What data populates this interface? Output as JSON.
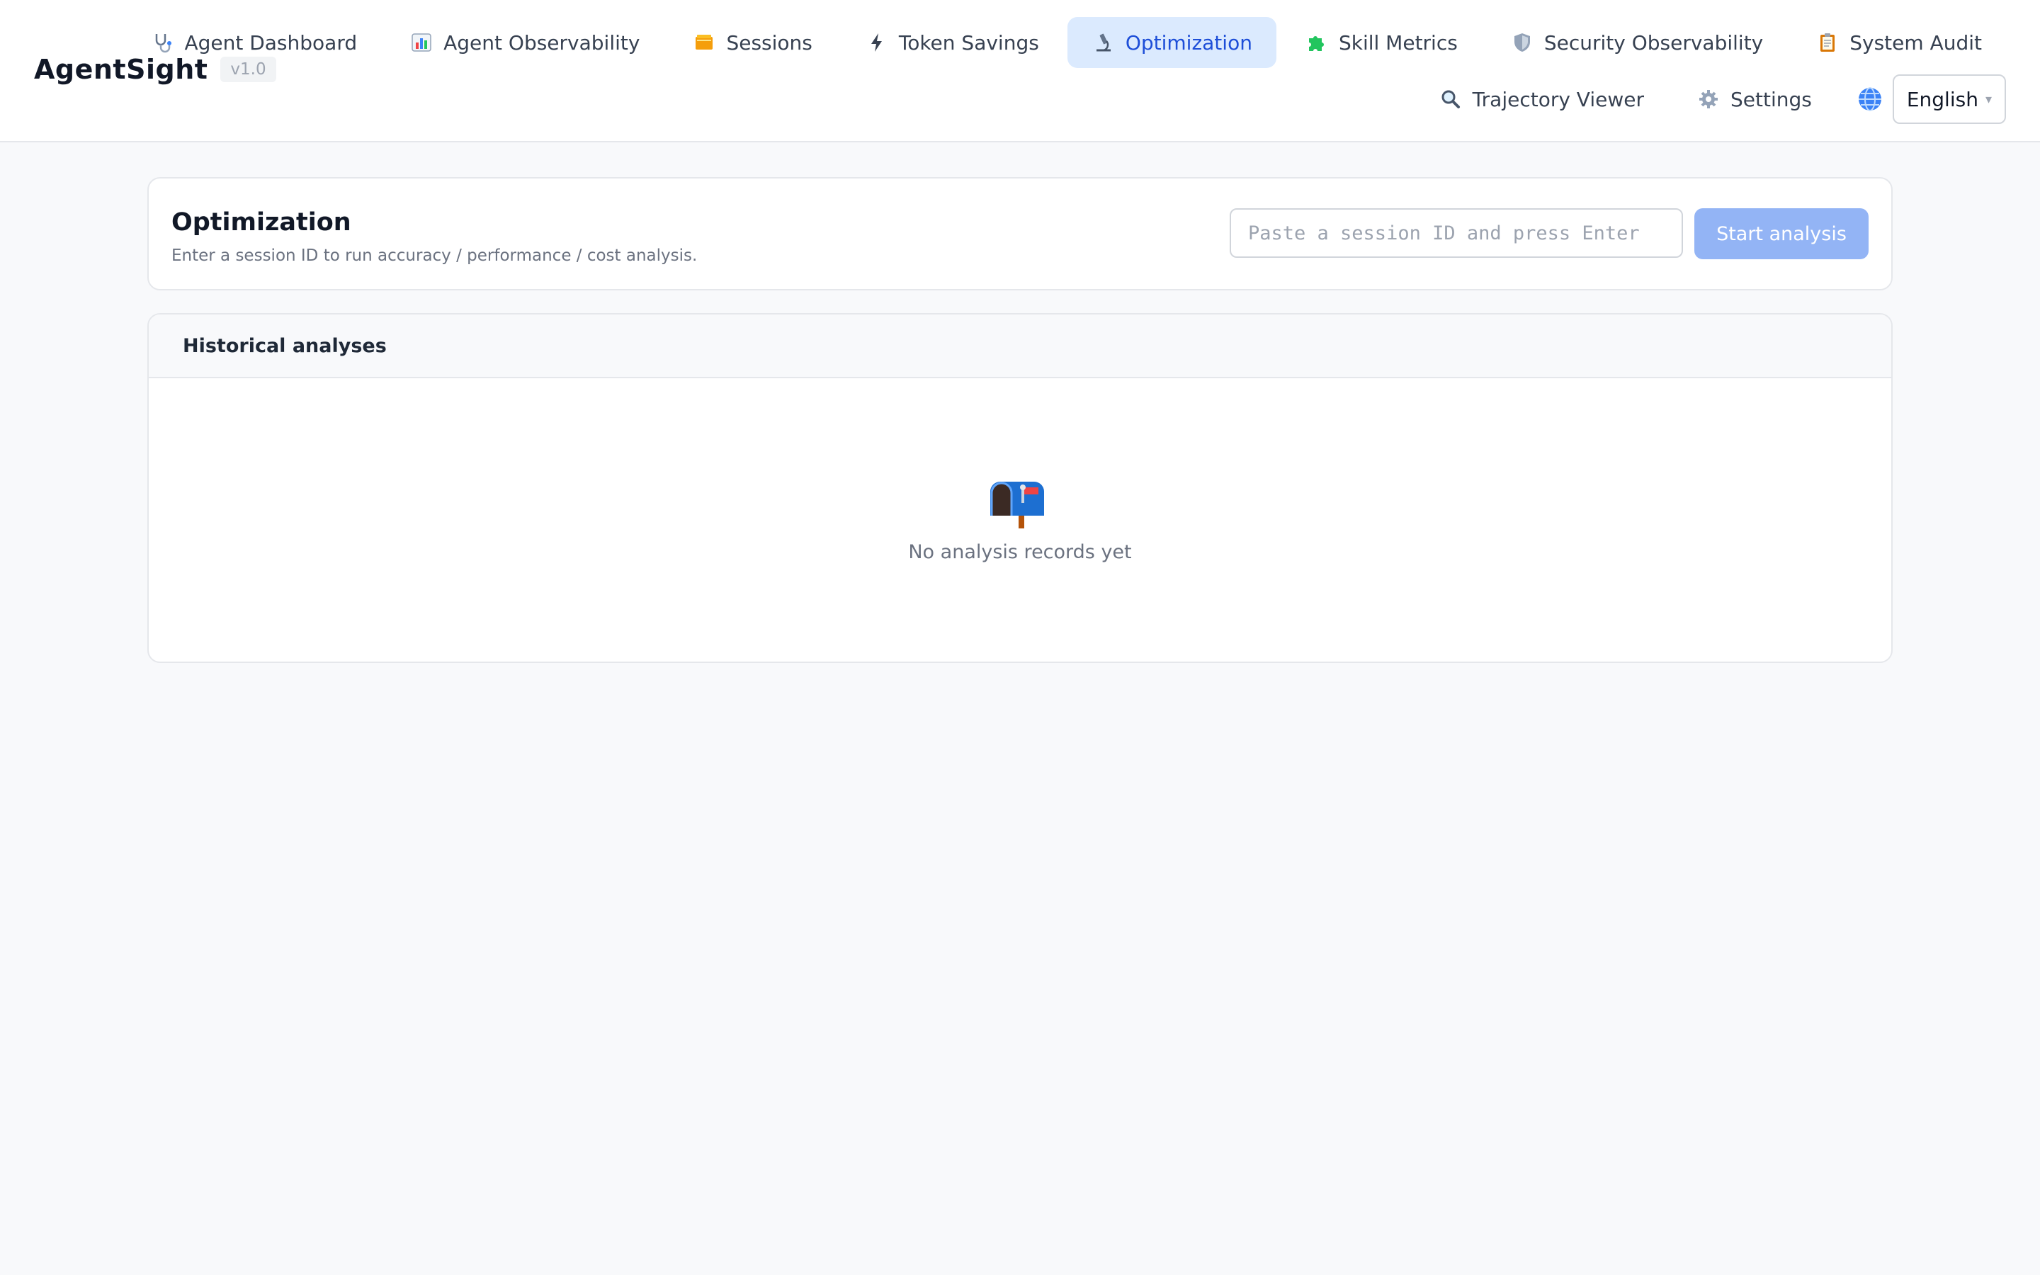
{
  "app": {
    "name": "AgentSight",
    "version": "v1.0"
  },
  "nav": {
    "row1": [
      {
        "label": "Agent Dashboard",
        "icon": "stethoscope-icon",
        "active": false
      },
      {
        "label": "Agent Observability",
        "icon": "bar-chart-icon",
        "active": false
      },
      {
        "label": "Sessions",
        "icon": "card-index-icon",
        "active": false
      },
      {
        "label": "Token Savings",
        "icon": "lightning-icon",
        "active": false
      },
      {
        "label": "Optimization",
        "icon": "microscope-icon",
        "active": true
      },
      {
        "label": "Skill Metrics",
        "icon": "puzzle-icon",
        "active": false
      },
      {
        "label": "Security Observability",
        "icon": "shield-icon",
        "active": false
      },
      {
        "label": "System Audit",
        "icon": "clipboard-icon",
        "active": false
      }
    ],
    "row2": [
      {
        "label": "Trajectory Viewer",
        "icon": "magnifier-icon",
        "active": false
      },
      {
        "label": "Settings",
        "icon": "gear-icon",
        "active": false
      }
    ],
    "language": {
      "icon": "globe-icon",
      "selected": "English"
    }
  },
  "optimization": {
    "title": "Optimization",
    "subtitle": "Enter a session ID to run accuracy / performance / cost analysis.",
    "input_value": "",
    "input_placeholder": "Paste a session ID and press Enter",
    "button_label": "Start analysis"
  },
  "history": {
    "title": "Historical analyses",
    "empty_icon": "mailbox-icon",
    "empty_text": "No analysis records yet"
  },
  "colors": {
    "accent": "#1d4ed8",
    "active_tab_bg": "#dbeafe",
    "button_disabled": "#93b4f5",
    "page_bg": "#f8f9fb"
  }
}
